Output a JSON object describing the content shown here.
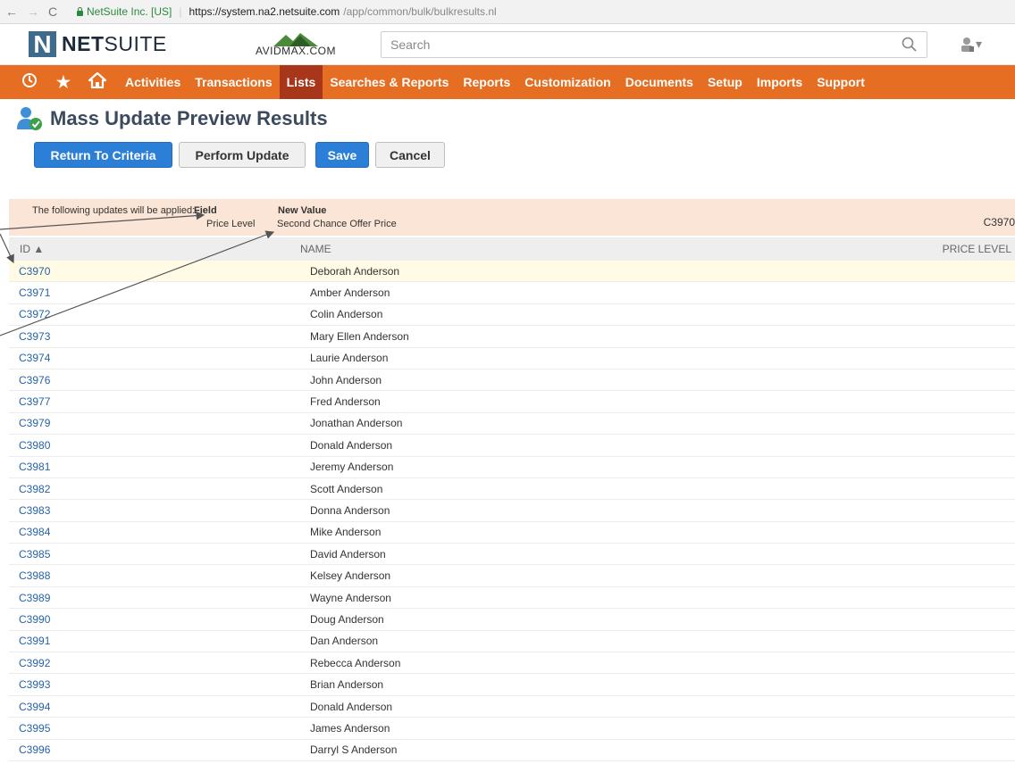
{
  "browser": {
    "secure_label": "NetSuite Inc. [US]",
    "url_host": "https://system.na2.netsuite.com",
    "url_path": "/app/common/bulk/bulkresults.nl"
  },
  "header": {
    "logo_text_bold": "NET",
    "logo_text": "SUITE",
    "brand": "AVIDMAX.COM",
    "search_placeholder": "Search"
  },
  "nav": {
    "items": [
      "Activities",
      "Transactions",
      "Lists",
      "Searches & Reports",
      "Reports",
      "Customization",
      "Documents",
      "Setup",
      "Imports",
      "Support"
    ],
    "active": "Lists",
    "color": "#e66e22",
    "active_color": "#a8361a"
  },
  "page": {
    "title": "Mass Update Preview Results"
  },
  "buttons": {
    "return": "Return To Criteria",
    "perform": "Perform Update",
    "save": "Save",
    "cancel": "Cancel"
  },
  "notice": {
    "intro": "The following updates will be applied:",
    "field_label": "Field",
    "field_value": "Price Level",
    "new_value_label": "New Value",
    "new_value": "Second Chance Offer Price",
    "ref": "C3970"
  },
  "table": {
    "col_id": "ID ▲",
    "col_name": "NAME",
    "col_price": "PRICE LEVEL",
    "rows": [
      {
        "id": "C3970",
        "name": "Deborah Anderson"
      },
      {
        "id": "C3971",
        "name": "Amber Anderson"
      },
      {
        "id": "C3972",
        "name": "Colin Anderson"
      },
      {
        "id": "C3973",
        "name": "Mary Ellen Anderson"
      },
      {
        "id": "C3974",
        "name": "Laurie Anderson"
      },
      {
        "id": "C3976",
        "name": "John Anderson"
      },
      {
        "id": "C3977",
        "name": "Fred Anderson"
      },
      {
        "id": "C3979",
        "name": "Jonathan Anderson"
      },
      {
        "id": "C3980",
        "name": "Donald Anderson"
      },
      {
        "id": "C3981",
        "name": "Jeremy Anderson"
      },
      {
        "id": "C3982",
        "name": "Scott Anderson"
      },
      {
        "id": "C3983",
        "name": "Donna Anderson"
      },
      {
        "id": "C3984",
        "name": "Mike Anderson"
      },
      {
        "id": "C3985",
        "name": "David Anderson"
      },
      {
        "id": "C3988",
        "name": "Kelsey Anderson"
      },
      {
        "id": "C3989",
        "name": "Wayne Anderson"
      },
      {
        "id": "C3990",
        "name": "Doug Anderson"
      },
      {
        "id": "C3991",
        "name": "Dan Anderson"
      },
      {
        "id": "C3992",
        "name": "Rebecca Anderson"
      },
      {
        "id": "C3993",
        "name": "Brian Anderson"
      },
      {
        "id": "C3994",
        "name": "Donald Anderson"
      },
      {
        "id": "C3995",
        "name": "James Anderson"
      },
      {
        "id": "C3996",
        "name": "Darryl S Anderson"
      }
    ]
  }
}
